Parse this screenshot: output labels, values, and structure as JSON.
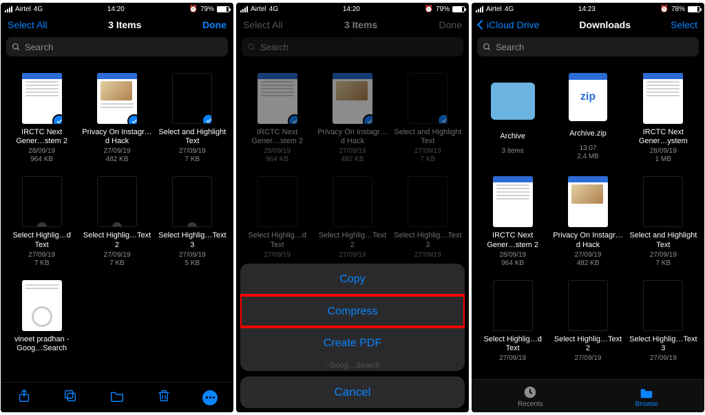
{
  "colors": {
    "accent": "#0a84ff",
    "highlight": "#ff0000"
  },
  "screens": [
    {
      "status": {
        "carrier": "Airtel",
        "net": "4G",
        "time": "14:20",
        "battery_pct": "79%"
      },
      "nav": {
        "left": "Select All",
        "title": "3 Items",
        "right": "Done"
      },
      "search": {
        "placeholder": "Search"
      },
      "files": [
        {
          "name": "IRCTC Next Gener…stem 2",
          "date": "28/09/19",
          "size": "964 KB",
          "thumb": "doc-a",
          "check": "on"
        },
        {
          "name": "Privacy On Instagr…d Hack",
          "date": "27/09/19",
          "size": "482 KB",
          "thumb": "doc-b",
          "check": "on"
        },
        {
          "name": "Select and Highlight Text",
          "date": "27/09/19",
          "size": "7 KB",
          "thumb": "empty",
          "check": "on"
        },
        {
          "name": "Select Highlig…d Text",
          "date": "27/09/19",
          "size": "7 KB",
          "thumb": "empty",
          "check": "off-circle"
        },
        {
          "name": "Select Highlig…Text 2",
          "date": "27/09/19",
          "size": "7 KB",
          "thumb": "empty",
          "check": "off-circle"
        },
        {
          "name": "Select Highlig…Text 3",
          "date": "27/09/19",
          "size": "5 KB",
          "thumb": "empty",
          "check": "off-circle"
        },
        {
          "name": "vineet pradhan - Goog…Search",
          "date": "",
          "size": "",
          "thumb": "doc-c",
          "check": ""
        }
      ],
      "toolbar": [
        "share",
        "duplicate",
        "folder",
        "trash",
        "more"
      ]
    },
    {
      "dim": true,
      "status": {
        "carrier": "Airtel",
        "net": "4G",
        "time": "14:20",
        "battery_pct": "79%"
      },
      "nav": {
        "left": "Select All",
        "title": "3 Items",
        "right": "Done",
        "dim": true
      },
      "search": {
        "placeholder": "Search"
      },
      "peek_top": "",
      "files": [
        {
          "name": "IRCTC Next Gener…stem 2",
          "date": "28/09/19",
          "size": "964 KB",
          "thumb": "doc-a",
          "check": "on"
        },
        {
          "name": "Privacy On Instagr…d Hack",
          "date": "27/09/19",
          "size": "482 KB",
          "thumb": "doc-b",
          "check": "on"
        },
        {
          "name": "Select and Highlight Text",
          "date": "27/09/19",
          "size": "7 KB",
          "thumb": "empty",
          "check": "on"
        },
        {
          "name": "Select Highlig…d Text",
          "date": "27/09/19",
          "size": "",
          "thumb": "empty",
          "check": ""
        },
        {
          "name": "Select Highlig…Text 2",
          "date": "27/09/19",
          "size": "",
          "thumb": "empty",
          "check": ""
        },
        {
          "name": "Select Highlig…Text 3",
          "date": "27/09/19",
          "size": "",
          "thumb": "empty",
          "check": ""
        }
      ],
      "sheet": {
        "peek": "- Goog…Search",
        "actions": [
          {
            "label": "Copy",
            "highlight": false
          },
          {
            "label": "Compress",
            "highlight": true
          },
          {
            "label": "Create PDF",
            "highlight": false
          }
        ],
        "cancel": "Cancel"
      }
    },
    {
      "status": {
        "carrier": "Airtel",
        "net": "4G",
        "time": "14:23",
        "battery_pct": "78%"
      },
      "nav": {
        "back": "iCloud Drive",
        "title": "Downloads",
        "right": "Select"
      },
      "search": {
        "placeholder": "Search"
      },
      "files": [
        {
          "name": "Archive",
          "date": "3 items",
          "size": "",
          "thumb": "folder"
        },
        {
          "name": "Archive.zip",
          "date": "13:07",
          "size": "2.4 MB",
          "thumb": "zip"
        },
        {
          "name": "IRCTC Next Gener…ystem",
          "date": "28/09/19",
          "size": "1 MB",
          "thumb": "doc-a"
        },
        {
          "name": "IRCTC Next Gener…stem 2",
          "date": "28/09/19",
          "size": "964 KB",
          "thumb": "doc-a"
        },
        {
          "name": "Privacy On Instagr…d Hack",
          "date": "27/09/19",
          "size": "482 KB",
          "thumb": "doc-b"
        },
        {
          "name": "Select and Highlight Text",
          "date": "27/09/19",
          "size": "7 KB",
          "thumb": "empty"
        },
        {
          "name": "Select Highlig…d Text",
          "date": "27/09/19",
          "size": "",
          "thumb": "empty"
        },
        {
          "name": "Select Highlig…Text 2",
          "date": "27/09/19",
          "size": "",
          "thumb": "empty"
        },
        {
          "name": "Select Highlig…Text 3",
          "date": "27/09/19",
          "size": "",
          "thumb": "empty"
        }
      ],
      "tabbar": {
        "recents": "Recents",
        "browse": "Browse",
        "active": "browse"
      }
    }
  ]
}
